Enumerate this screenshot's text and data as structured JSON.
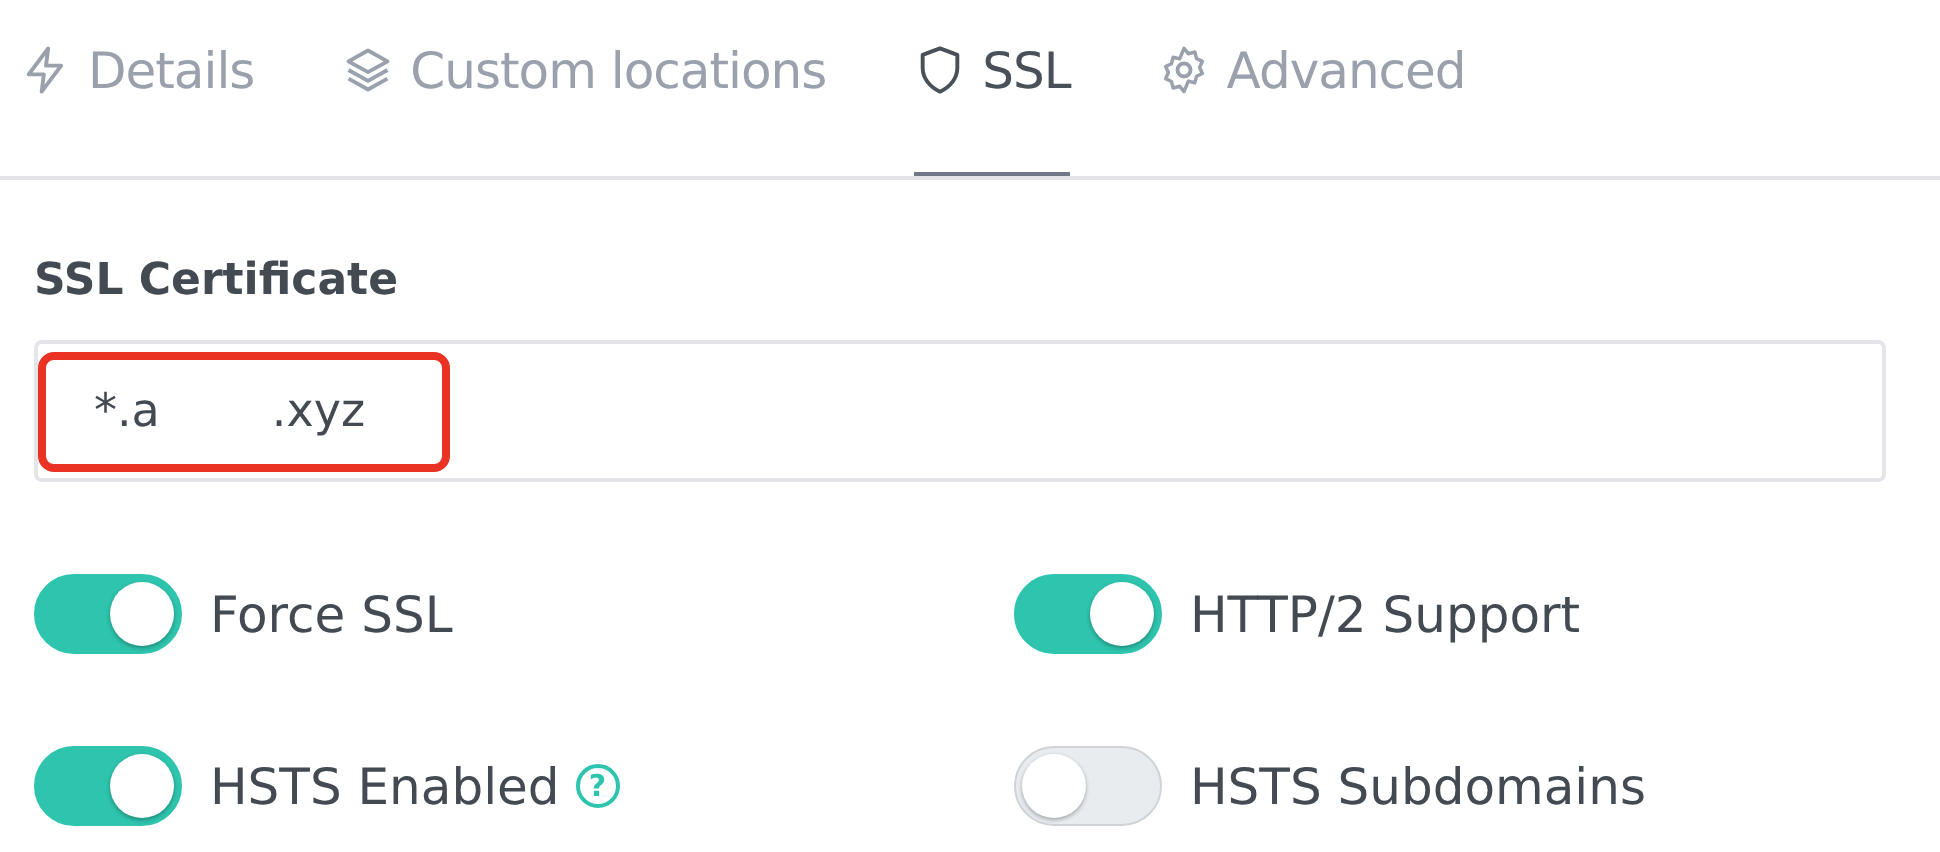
{
  "tabs": [
    {
      "label": "Details",
      "kind": "bolt",
      "selected": false
    },
    {
      "label": "Custom locations",
      "kind": "layers",
      "selected": false
    },
    {
      "label": "SSL",
      "kind": "shield",
      "selected": true
    },
    {
      "label": "Advanced",
      "kind": "gear",
      "selected": false
    }
  ],
  "certificate": {
    "label": "SSL Certificate",
    "value_start": "*.a",
    "value_end": ".xyz",
    "highlighted": true
  },
  "options": [
    {
      "label": "Force SSL",
      "on": true
    },
    {
      "label": "HTTP/2 Support",
      "on": true
    },
    {
      "label": "HSTS Enabled",
      "on": true,
      "help": "?"
    },
    {
      "label": "HSTS Subdomains",
      "on": false
    }
  ]
}
